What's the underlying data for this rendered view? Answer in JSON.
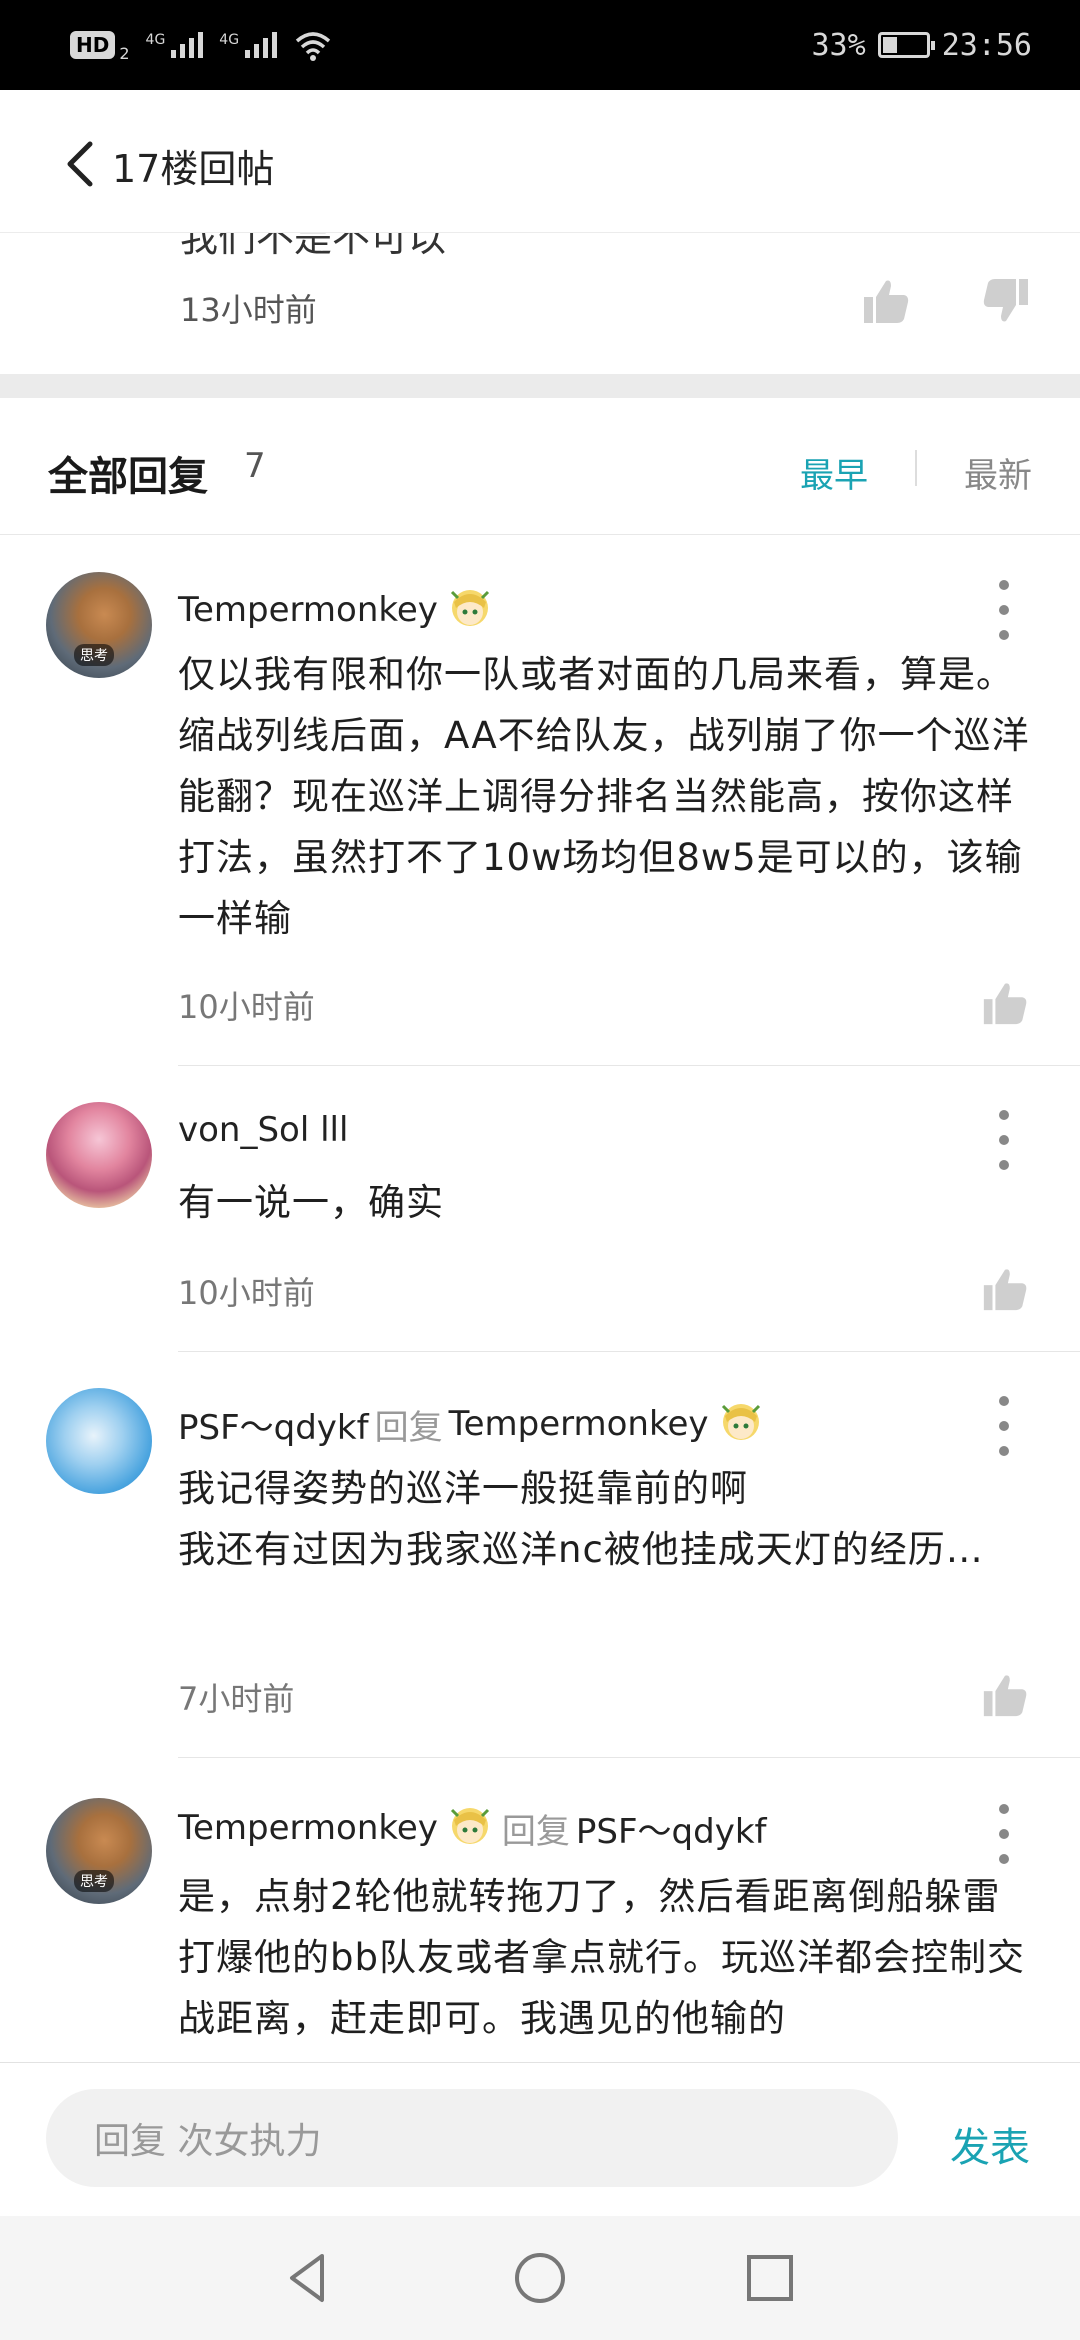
{
  "status_bar": {
    "hd": "HD",
    "hd_sub": "2",
    "sig1": "4G",
    "sig2": "4G",
    "battery_percent": "33%",
    "battery_level": 0.33,
    "time": "23:56"
  },
  "header": {
    "title": "17楼回帖"
  },
  "original_post": {
    "cut_text": "我们不是不可以",
    "time": "13小时前"
  },
  "replies_header": {
    "title": "全部回复",
    "count": "7",
    "sort_early": "最早",
    "sort_newest": "最新"
  },
  "comments": [
    {
      "user": "Tempermonkey",
      "reply_word": "",
      "reply_to": "",
      "avatar_tag": "思考",
      "text": "仅以我有限和你一队或者对面的几局来看，算是。缩战列线后面，AA不给队友，战列崩了你一个巡洋能翻？现在巡洋上调得分排名当然能高，按你这样打法，虽然打不了10w场均但8w5是可以的，该输一样输",
      "time": "10小时前"
    },
    {
      "user": "von_Sol lll",
      "text": "有一说一，确实",
      "time": "10小时前"
    },
    {
      "user": "PSF～qdykf",
      "reply_word": "回复",
      "reply_to": "Tempermonkey",
      "text": "我记得姿势的巡洋一般挺靠前的啊\n我还有过因为我家巡洋nc被他挂成天灯的经历…",
      "time": "7小时前"
    },
    {
      "user": "Tempermonkey",
      "reply_word": "回复",
      "reply_to": "PSF～qdykf",
      "avatar_tag": "思考",
      "text": "是，点射2轮他就转拖刀了，然后看距离倒船躲雷打爆他的bb队友或者拿点就行。玩巡洋都会控制交战距离，赶走即可。我遇见的他输的"
    }
  ],
  "reply_bar": {
    "placeholder": "回复 次女执力",
    "send": "发表"
  },
  "colors": {
    "accent": "#1aa3b3",
    "text": "#1f1f1f",
    "muted": "#777777"
  },
  "icons": [
    "back-arrow-icon",
    "thumb-up-icon",
    "thumb-down-icon",
    "more-vert-icon",
    "nav-back-icon",
    "nav-home-icon",
    "nav-recents-icon"
  ]
}
